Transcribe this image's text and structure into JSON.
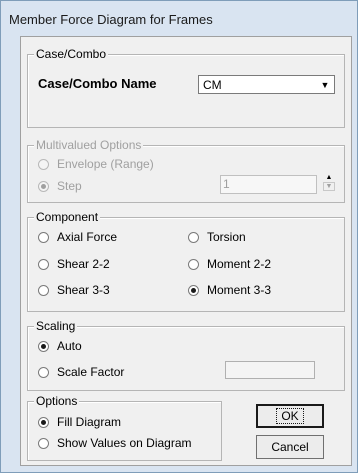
{
  "window": {
    "title": "Member Force Diagram for Frames"
  },
  "case_combo": {
    "legend": "Case/Combo",
    "name_label": "Case/Combo Name",
    "selected": "CM"
  },
  "multivalued": {
    "legend": "Multivalued Options",
    "envelope_label": "Envelope (Range)",
    "step_label": "Step",
    "step_value": "1",
    "selected": "Step"
  },
  "component": {
    "legend": "Component",
    "options": [
      "Axial Force",
      "Torsion",
      "Shear 2-2",
      "Moment 2-2",
      "Shear 3-3",
      "Moment 3-3"
    ],
    "selected": "Moment 3-3"
  },
  "scaling": {
    "legend": "Scaling",
    "auto_label": "Auto",
    "scale_factor_label": "Scale Factor",
    "scale_factor_value": "",
    "selected": "Auto"
  },
  "options": {
    "legend": "Options",
    "fill_label": "Fill Diagram",
    "show_values_label": "Show Values on Diagram",
    "selected": "Fill Diagram"
  },
  "buttons": {
    "ok": "OK",
    "cancel": "Cancel"
  },
  "icons": {
    "dropdown": "chevron-down-icon",
    "spin_up": "spin-up-icon",
    "spin_down": "spin-down-icon"
  }
}
